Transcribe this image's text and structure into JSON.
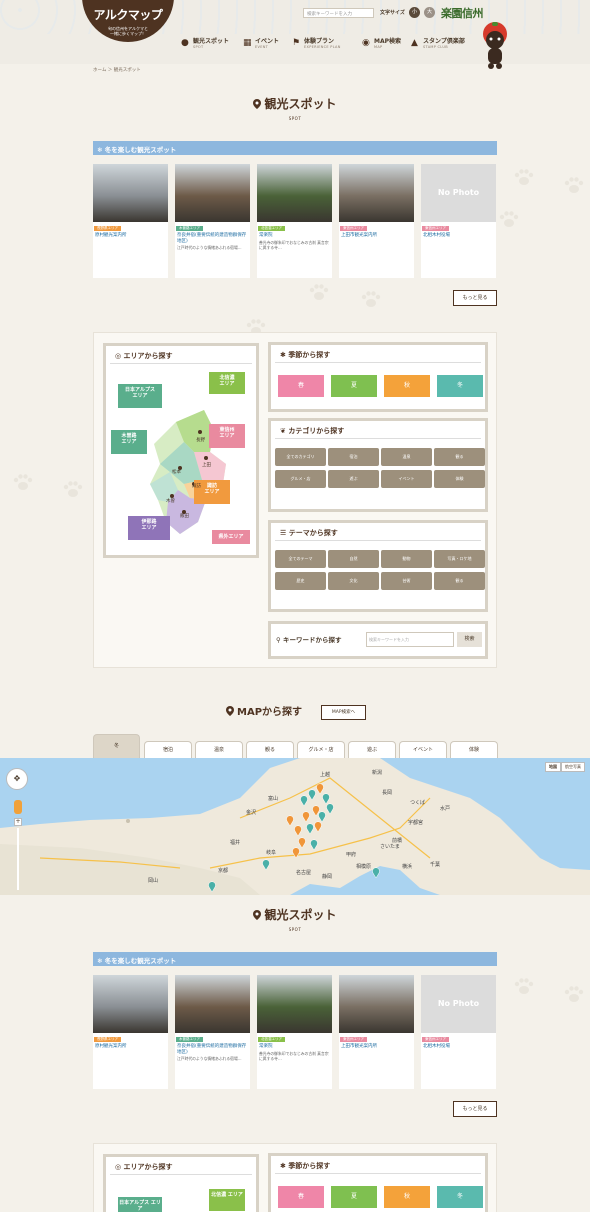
{
  "header": {
    "logo_title": "アルクマップ",
    "logo_sub1": "旬の信州をアルクマと",
    "logo_sub2": "一緒に歩くマップ！",
    "search_placeholder": "検索キーワードを入力",
    "font_size_label": "文字サイズ",
    "font_small": "小",
    "font_large": "大",
    "brand": "楽園信州",
    "nav": [
      {
        "label": "観光スポット",
        "sub": "SPOT"
      },
      {
        "label": "イベント",
        "sub": "EVENT"
      },
      {
        "label": "体験プラン",
        "sub": "EXPERIENCE PLAN"
      },
      {
        "label": "MAP検索",
        "sub": "MAP"
      },
      {
        "label": "スタンプ倶楽部",
        "sub": "STAMP CLUB"
      }
    ]
  },
  "breadcrumb": "ホーム ＞ 観光スポット",
  "section": {
    "title": "観光スポット",
    "sub": "SPOT"
  },
  "winter_bar": "冬を楽しむ観光スポット",
  "cards": [
    {
      "tag": "長野県エリア",
      "tag_color": "#f19a3e",
      "title": "原村観光案内所",
      "desc": "",
      "photo": "#8a8f94"
    },
    {
      "tag": "木曽路エリア",
      "tag_color": "#5aae8c",
      "title": "奈良井宿(重要伝統的建造物群保存地区)",
      "desc": "江戸時代のような情緒あふれる宿場…",
      "photo": "#6d5a48"
    },
    {
      "tag": "北信濃エリア",
      "tag_color": "#8ac04a",
      "title": "常楽院",
      "desc": "善光寺の御朱印でおなじみの古刹 真言宗に属する寺…",
      "photo": "#4a6238"
    },
    {
      "tag": "東信州エリア",
      "tag_color": "#e98a9f",
      "title": "上田市観光案内所",
      "desc": "",
      "photo": "#7a6f63"
    },
    {
      "tag": "東信州エリア",
      "tag_color": "#e98a9f",
      "title": "北相木村役場",
      "desc": "",
      "photo": "#e0e0e0"
    }
  ],
  "no_photo": "No Photo",
  "more_label": "もっと見る",
  "area_search": {
    "title": "エリアから探す",
    "areas": [
      {
        "name": "北信濃\nエリア",
        "color": "#8ac04a"
      },
      {
        "name": "日本アルプス\nエリア",
        "color": "#5aae8c"
      },
      {
        "name": "東信州\nエリア",
        "color": "#e98a9f"
      },
      {
        "name": "木曽路\nエリア",
        "color": "#5aae8c"
      },
      {
        "name": "諏訪\nエリア",
        "color": "#f19a3e"
      },
      {
        "name": "伊那路\nエリア",
        "color": "#8f74b8"
      },
      {
        "name": "県外エリア",
        "color": "#e98a9f"
      }
    ],
    "cities": [
      "長野",
      "上田",
      "松本",
      "諏訪",
      "木曽",
      "飯田"
    ]
  },
  "season_search": {
    "title": "季節から探す",
    "seasons": [
      {
        "label": "春",
        "color": "#ef86a8"
      },
      {
        "label": "夏",
        "color": "#7fc050"
      },
      {
        "label": "秋",
        "color": "#f4a23a"
      },
      {
        "label": "冬",
        "color": "#5abaae"
      }
    ]
  },
  "category_search": {
    "title": "カテゴリから探す",
    "items": [
      "全てのカテゴリ",
      "宿泊",
      "温泉",
      "観る",
      "グルメ・店",
      "遊ぶ",
      "イベント",
      "体験"
    ]
  },
  "theme_search": {
    "title": "テーマから探す",
    "items": [
      "全てのテーマ",
      "自然",
      "動物",
      "写真・ロケ地",
      "歴史",
      "文化",
      "芸術",
      "観る"
    ]
  },
  "keyword_search": {
    "title": "キーワードから探す",
    "placeholder": "検索キーワードを入力",
    "button": "検索"
  },
  "map_search": {
    "title": "MAPから探す",
    "button": "MAP検索へ",
    "tabs": [
      "冬",
      "宿泊",
      "温泉",
      "観る",
      "グルメ・店",
      "遊ぶ",
      "イベント",
      "体験"
    ],
    "map_type": [
      "地図",
      "航空写真"
    ],
    "cities": [
      "新潟",
      "長岡",
      "上越",
      "富山",
      "金沢",
      "福井",
      "岐阜",
      "名古屋",
      "静岡",
      "甲府",
      "前橋",
      "宇都宮",
      "水戸",
      "さいたま",
      "横浜",
      "千葉",
      "京都",
      "岡山",
      "相模原",
      "つくば"
    ]
  }
}
